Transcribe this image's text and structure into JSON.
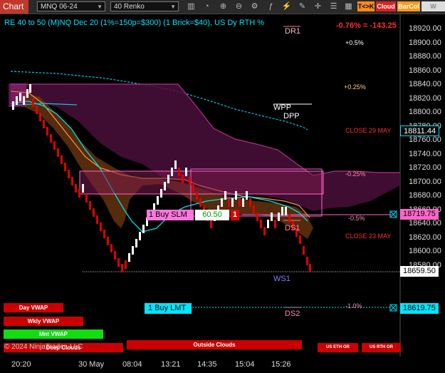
{
  "toolbar": {
    "tab_label": "Chart",
    "instrument": "MNQ 06-24",
    "bar_type": "40 Renko",
    "btn_tk": "T<>K",
    "btn_cloud": "Cloud",
    "btn_barcol": "BarCol",
    "btn_w": "W VWAP"
  },
  "chart": {
    "title": "RE 40 to 50 (M)NQ Dec 20 (1%=150p=$300) (1 Brick=$40), US Dy RTH %",
    "change": "-0.76% = -143.25",
    "copyright": "© 2024 NinjaTrader, LLC",
    "levels": {
      "dr1": "DR1",
      "wpp": "WPP",
      "dpp": "DPP",
      "ds1": "DS1",
      "ws1": "WS1",
      "ds2": "DS2",
      "p05": "+0.5%",
      "p025": "+0.25%",
      "close29": "CLOSE 29 MAY",
      "m025": "-0.25%",
      "m05": "-0.5%",
      "close23": "CLOSE 23 MAY",
      "m10": "-1.0%"
    },
    "y_ticks": [
      "18920.00",
      "18900.00",
      "18880.00",
      "18860.00",
      "18840.00",
      "18820.00",
      "18800.00",
      "18780.00",
      "18760.00",
      "18740.00",
      "18720.00",
      "18700.00",
      "18680.00",
      "18660.00",
      "18640.00",
      "18620.00",
      "18600.00",
      "18580.00"
    ],
    "price_tags": {
      "close_tag": "18811.44",
      "slm_tag": "18719.75",
      "last_tag": "18659.50",
      "lmt_tag": "18619.75"
    },
    "x_ticks": [
      "20:20",
      "30 May",
      "08:04",
      "13:21",
      "14:35",
      "15:04",
      "15:26"
    ]
  },
  "orders": {
    "buy_slm": "1 Buy SLM",
    "slm_price": "60.50",
    "slm_qty": "1",
    "buy_lmt": "1 Buy LMT"
  },
  "buttons": {
    "day_vwap": "Day VWAP",
    "wkly_vwap": "Wkly VWAP",
    "mnt_vwap": "Mnt VWAP",
    "deep_clouds": "Deep Clouds",
    "outside_clouds": "Outside Clouds",
    "us_eth": "US ETH OR",
    "us_rth": "US RTH OR"
  },
  "colors": {
    "background": "#000000",
    "up_brick": "#ffffff",
    "down_brick": "#e00000",
    "cyan": "#00e5ff",
    "magenta": "#c040c0",
    "orange": "#ff9a3c",
    "accent_red": "#ff3030"
  }
}
